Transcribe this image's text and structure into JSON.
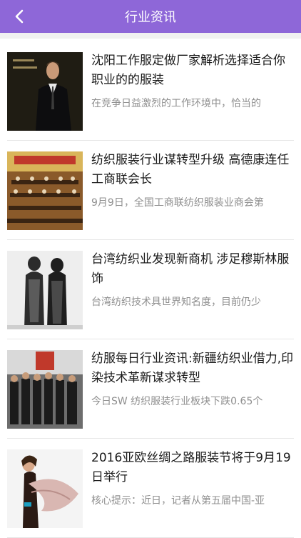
{
  "header": {
    "title": "行业资讯"
  },
  "articles": [
    {
      "title": "沈阳工作服定做厂家解析选择适合你职业的的服装",
      "summary": "在竞争日益激烈的工作环境中，恰当的",
      "image": "man-in-suit-photo"
    },
    {
      "title": "纺织服装行业谋转型升级 高德康连任工商联会长",
      "summary": "9月9日，全国工商联纺织服装业商会第",
      "image": "conference-hall-photo"
    },
    {
      "title": "台湾纺织业发现新商机 涉足穆斯林服饰",
      "summary": "台湾纺织技术具世界知名度，目前仍少",
      "image": "muslim-garments-photo"
    },
    {
      "title": "纺服每日行业资讯:新疆纺织业借力,印染技术革新谋求转型",
      "summary": "今日SW 纺织服装行业板块下跌0.65个",
      "image": "group-photo"
    },
    {
      "title": "2016亚欧丝绸之路服装节将于9月19日举行",
      "summary": "核心提示：近日，记者从第五届中国-亚",
      "image": "model-with-scarf-photo"
    }
  ],
  "colors": {
    "header": "#8e67d8",
    "title": "#1a1a1a",
    "summary": "#8f8f8f"
  }
}
